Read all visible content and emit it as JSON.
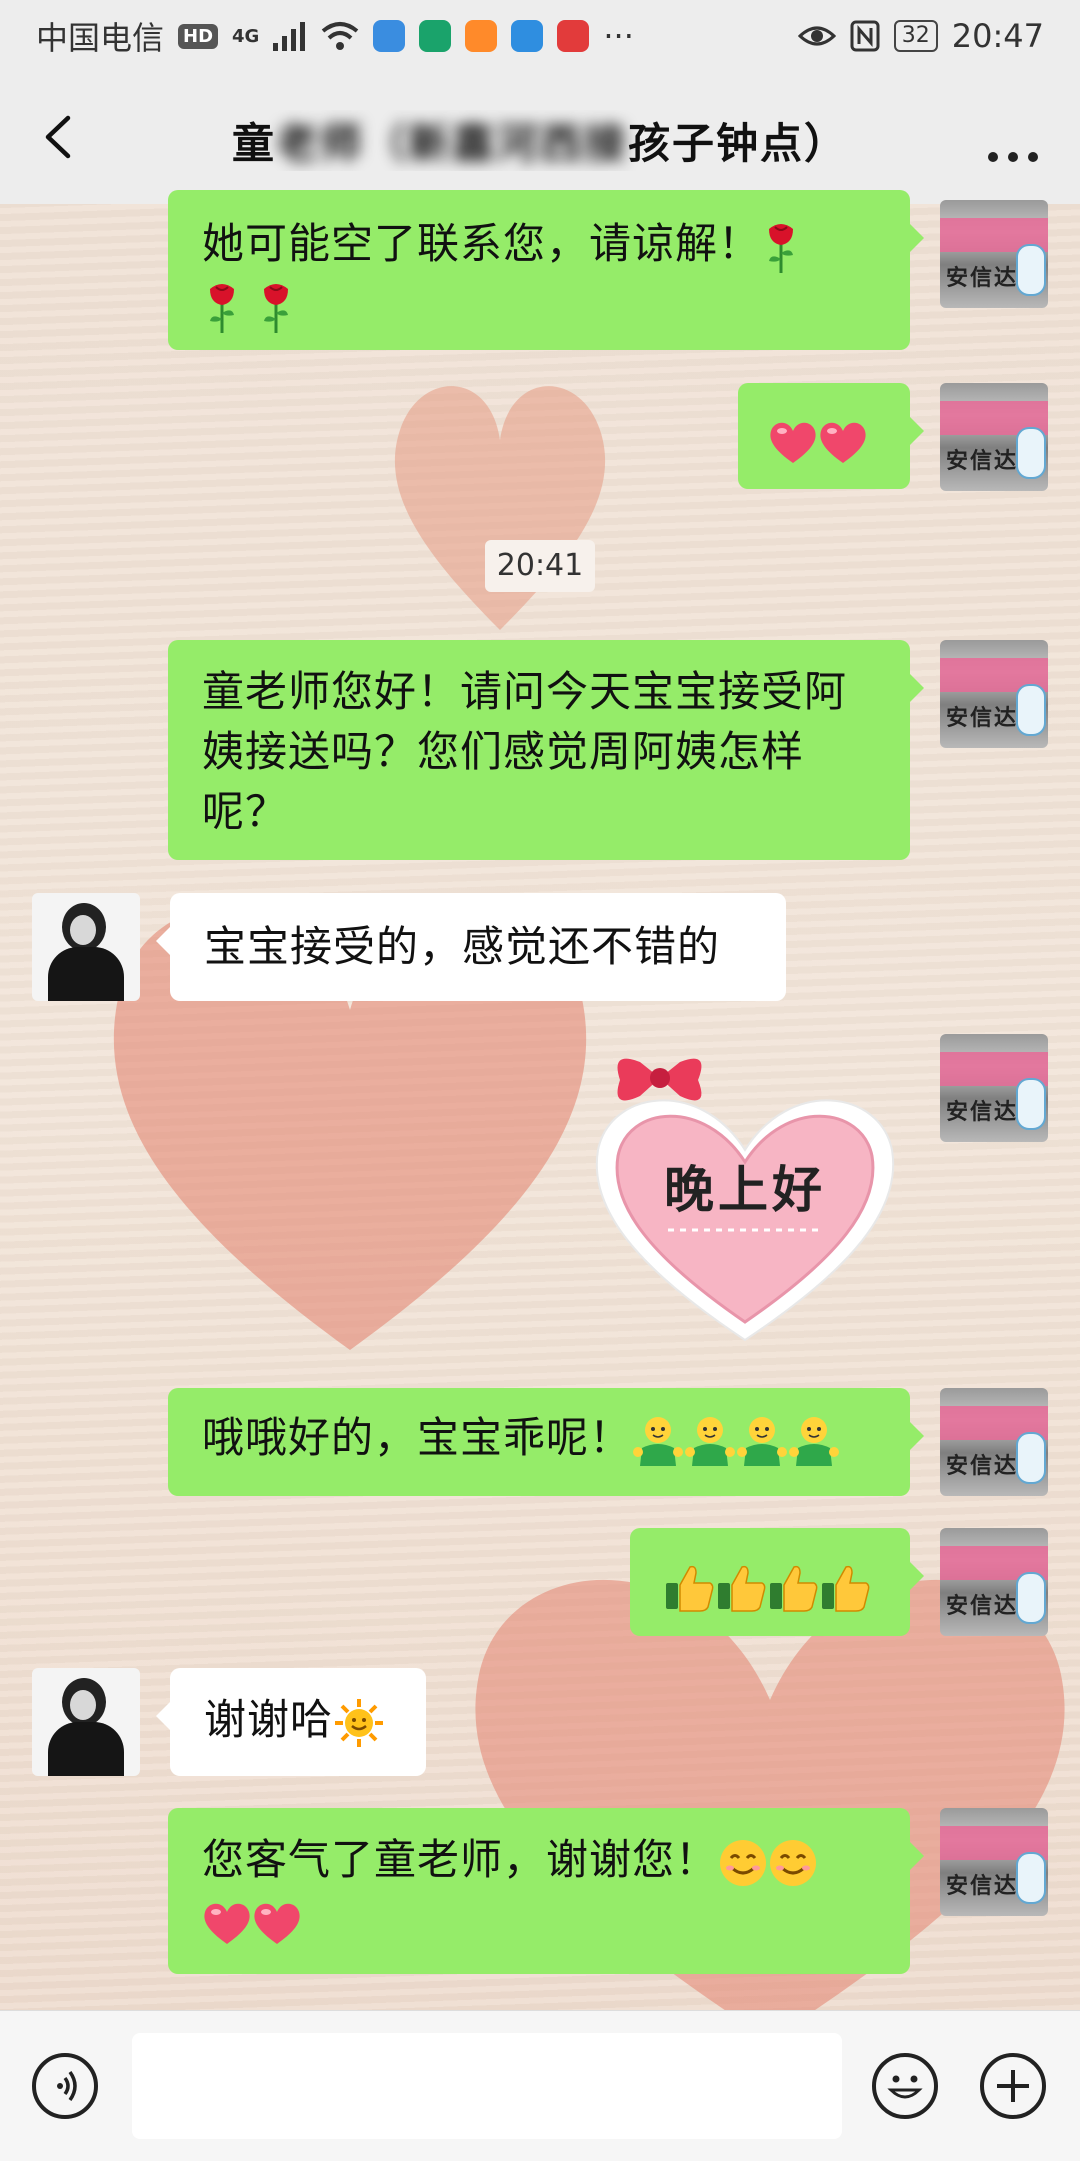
{
  "status_bar": {
    "carrier": "中国电信",
    "hd_label": "HD",
    "network": "4G",
    "more_dots": "···",
    "battery": "32",
    "time": "20:47"
  },
  "header": {
    "title_visible_start": "童",
    "title_visible_end": "孩子钟点）",
    "title_blurred": "老师（新嘉河西接"
  },
  "messages": [
    {
      "side": "out",
      "text": "她可能空了联系您，请谅解！",
      "emoji": [
        "rose-emoji",
        "rose-emoji",
        "rose-emoji"
      ]
    },
    {
      "side": "out",
      "text": "",
      "emoji": [
        "heart-emoji",
        "heart-emoji"
      ]
    },
    {
      "side": "out",
      "text": "童老师您好！请问今天宝宝接受阿姨接送吗？您们感觉周阿姨怎样呢？",
      "lines": [
        "童老师您好！请问今天宝宝接受阿",
        "姨接送吗？您们感觉周阿姨怎样",
        "呢？"
      ]
    },
    {
      "side": "in",
      "text": "宝宝接受的，感觉还不错的"
    },
    {
      "side": "out",
      "sticker_text": "晚上好"
    },
    {
      "side": "out",
      "text": "哦哦好的，宝宝乖呢！",
      "emoji": [
        "green-figure-emoji",
        "green-figure-emoji",
        "green-figure-emoji",
        "green-figure-emoji"
      ]
    },
    {
      "side": "out",
      "text": "",
      "emoji": [
        "thumbs-up-emoji",
        "thumbs-up-emoji",
        "thumbs-up-emoji",
        "thumbs-up-emoji"
      ]
    },
    {
      "side": "in",
      "text": "谢谢哈",
      "emoji": [
        "sun-emoji"
      ]
    },
    {
      "side": "out",
      "text": "您客气了童老师，谢谢您！",
      "emoji": [
        "smile-emoji",
        "smile-emoji",
        "heart-emoji",
        "heart-emoji"
      ]
    }
  ],
  "timestamp": "20:41",
  "avatar_me": {
    "sign_text": "安信达"
  },
  "icons": {
    "back": "back-arrow-icon",
    "more": "more-icon",
    "voice": "voice-icon",
    "emoji": "emoji-icon",
    "plus": "plus-icon"
  },
  "colors": {
    "outgoing_bubble": "#95ec69",
    "incoming_bubble": "#ffffff",
    "bar_bg": "#ededed",
    "heart_bg": "#e48b78"
  }
}
